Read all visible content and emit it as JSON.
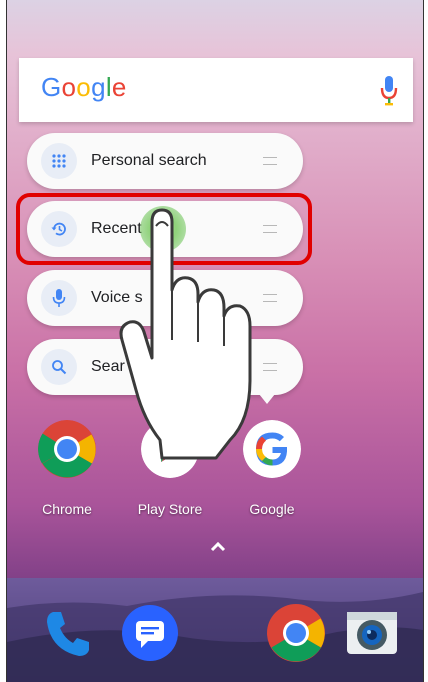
{
  "search": {
    "logo_letters": [
      {
        "ch": "G",
        "color": "#4285F4"
      },
      {
        "ch": "o",
        "color": "#EA4335"
      },
      {
        "ch": "o",
        "color": "#FBBC05"
      },
      {
        "ch": "g",
        "color": "#4285F4"
      },
      {
        "ch": "l",
        "color": "#34A853"
      },
      {
        "ch": "e",
        "color": "#EA4335"
      }
    ],
    "mic_icon": "microphone-icon"
  },
  "shortcuts": [
    {
      "label": "Personal search",
      "icon": "apps-grid-icon"
    },
    {
      "label": "Recent",
      "icon": "history-icon"
    },
    {
      "label": "Voice s",
      "icon": "microphone-icon"
    },
    {
      "label": "Sear",
      "icon": "search-icon"
    }
  ],
  "apps": [
    {
      "label": "Chrome",
      "icon": "chrome-icon"
    },
    {
      "label": "Play Store",
      "icon": "play-store-icon"
    },
    {
      "label": "Google",
      "icon": "google-icon"
    }
  ],
  "dock": [
    {
      "icon": "phone-icon"
    },
    {
      "icon": "messages-icon"
    },
    {
      "icon": "chrome-icon"
    },
    {
      "icon": "camera-icon"
    }
  ],
  "colors": {
    "highlight": "#e10000",
    "accent_blue": "#4285F4"
  }
}
